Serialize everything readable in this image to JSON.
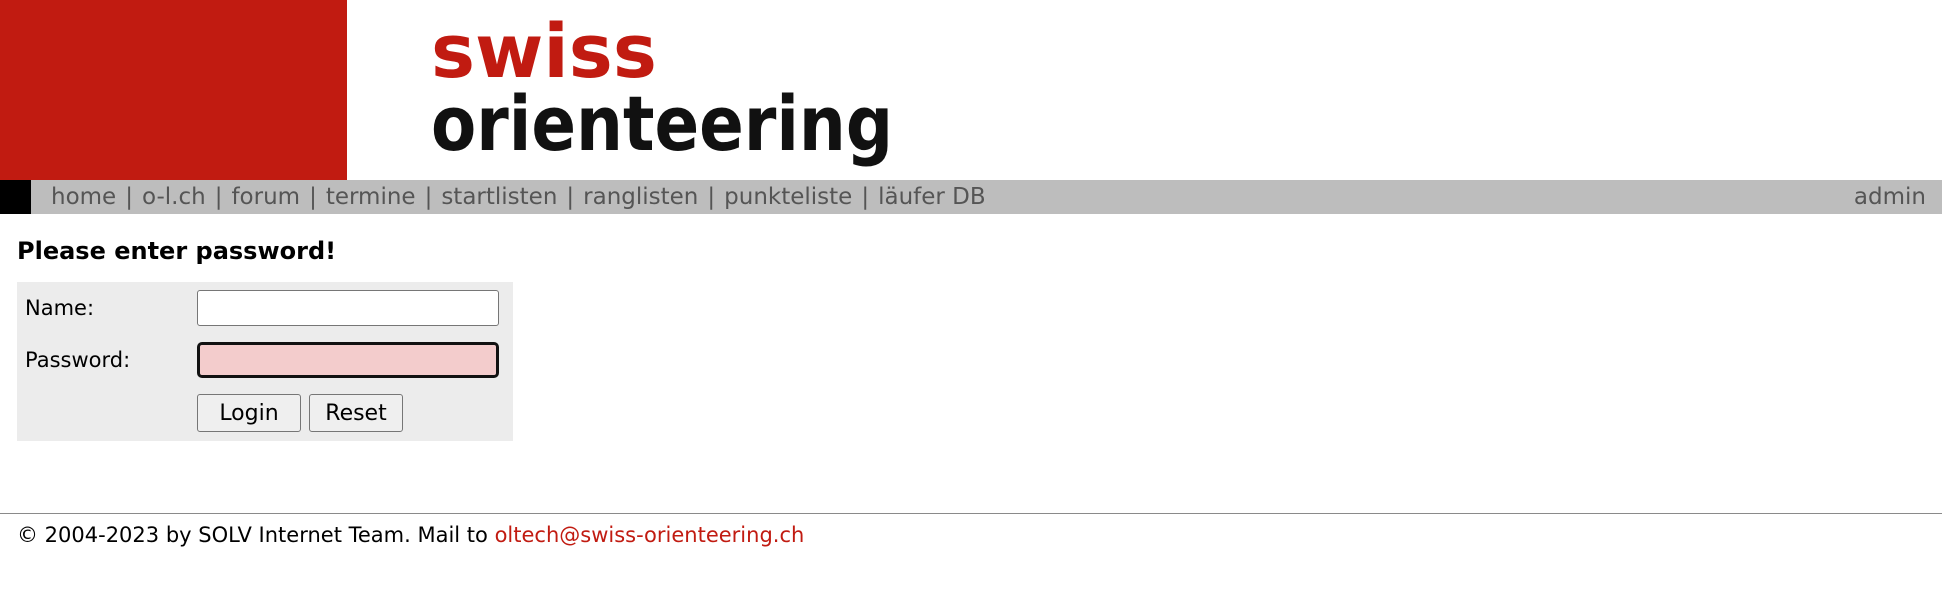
{
  "header": {
    "logo": {
      "line1": "swiss",
      "line2": "orienteering",
      "alt": "swiss orienteering"
    }
  },
  "nav": {
    "items": [
      {
        "label": "home"
      },
      {
        "label": "o-l.ch"
      },
      {
        "label": "forum"
      },
      {
        "label": "termine"
      },
      {
        "label": "startlisten"
      },
      {
        "label": "ranglisten"
      },
      {
        "label": "punkteliste"
      },
      {
        "label": "läufer DB"
      }
    ],
    "separator": "|",
    "admin": "admin"
  },
  "login": {
    "heading": "Please enter password!",
    "name_label": "Name:",
    "name_value": "",
    "password_label": "Password:",
    "password_value": "",
    "login_button": "Login",
    "reset_button": "Reset"
  },
  "footer": {
    "text": "© 2004-2023 by SOLV Internet Team. Mail to",
    "email": "oltech@swiss-orienteering.ch"
  },
  "colors": {
    "brand_red": "#c11b11",
    "nav_bg": "#bdbdbd",
    "nav_text": "#555555",
    "form_bg": "#ececec",
    "password_field_bg": "#f3cccc"
  }
}
